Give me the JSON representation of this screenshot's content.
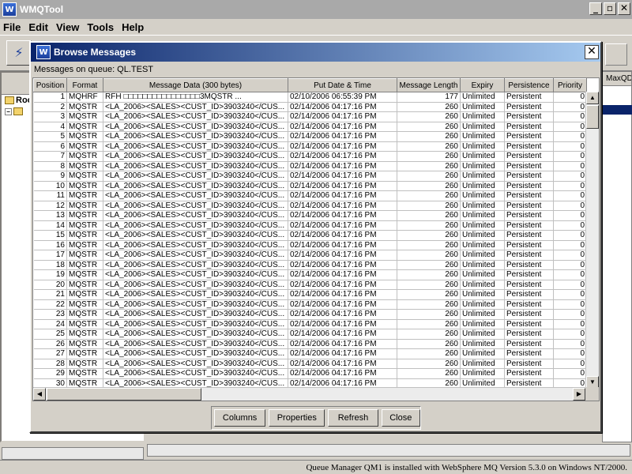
{
  "app": {
    "title": "WMQTool",
    "icon": "wmq-app-icon"
  },
  "window_controls": {
    "minimize": "_",
    "restore": "▫",
    "close": "✕"
  },
  "menu": [
    "File",
    "Edit",
    "View",
    "Tools",
    "Help"
  ],
  "tree": {
    "root_label": "Roo"
  },
  "right_panel": {
    "header": "MaxQD"
  },
  "status": {
    "text": "Queue Manager QM1 is installed with WebSphere MQ Version 5.3.0 on Windows NT/2000."
  },
  "dialog": {
    "title": "Browse Messages",
    "queue_label": "Messages on queue: QL.TEST",
    "columns": [
      "Position",
      "Format",
      "Message Data (300 bytes)",
      "Put Date & Time",
      "Message Length",
      "Expiry",
      "Persistence",
      "Priority"
    ],
    "rows": [
      [
        "1",
        "MQHRF",
        "RFH □□□□□□□□□□□□□□□□3MQSTR    ...",
        "02/10/2006 06:55:39 PM",
        "177",
        "Unlimited",
        "Persistent",
        "0"
      ],
      [
        "2",
        "MQSTR",
        "<LA_2006><SALES><CUST_ID>3903240</CUS...",
        "02/14/2006 04:17:16 PM",
        "260",
        "Unlimited",
        "Persistent",
        "0"
      ],
      [
        "3",
        "MQSTR",
        "<LA_2006><SALES><CUST_ID>3903240</CUS...",
        "02/14/2006 04:17:16 PM",
        "260",
        "Unlimited",
        "Persistent",
        "0"
      ],
      [
        "4",
        "MQSTR",
        "<LA_2006><SALES><CUST_ID>3903240</CUS...",
        "02/14/2006 04:17:16 PM",
        "260",
        "Unlimited",
        "Persistent",
        "0"
      ],
      [
        "5",
        "MQSTR",
        "<LA_2006><SALES><CUST_ID>3903240</CUS...",
        "02/14/2006 04:17:16 PM",
        "260",
        "Unlimited",
        "Persistent",
        "0"
      ],
      [
        "6",
        "MQSTR",
        "<LA_2006><SALES><CUST_ID>3903240</CUS...",
        "02/14/2006 04:17:16 PM",
        "260",
        "Unlimited",
        "Persistent",
        "0"
      ],
      [
        "7",
        "MQSTR",
        "<LA_2006><SALES><CUST_ID>3903240</CUS...",
        "02/14/2006 04:17:16 PM",
        "260",
        "Unlimited",
        "Persistent",
        "0"
      ],
      [
        "8",
        "MQSTR",
        "<LA_2006><SALES><CUST_ID>3903240</CUS...",
        "02/14/2006 04:17:16 PM",
        "260",
        "Unlimited",
        "Persistent",
        "0"
      ],
      [
        "9",
        "MQSTR",
        "<LA_2006><SALES><CUST_ID>3903240</CUS...",
        "02/14/2006 04:17:16 PM",
        "260",
        "Unlimited",
        "Persistent",
        "0"
      ],
      [
        "10",
        "MQSTR",
        "<LA_2006><SALES><CUST_ID>3903240</CUS...",
        "02/14/2006 04:17:16 PM",
        "260",
        "Unlimited",
        "Persistent",
        "0"
      ],
      [
        "11",
        "MQSTR",
        "<LA_2006><SALES><CUST_ID>3903240</CUS...",
        "02/14/2006 04:17:16 PM",
        "260",
        "Unlimited",
        "Persistent",
        "0"
      ],
      [
        "12",
        "MQSTR",
        "<LA_2006><SALES><CUST_ID>3903240</CUS...",
        "02/14/2006 04:17:16 PM",
        "260",
        "Unlimited",
        "Persistent",
        "0"
      ],
      [
        "13",
        "MQSTR",
        "<LA_2006><SALES><CUST_ID>3903240</CUS...",
        "02/14/2006 04:17:16 PM",
        "260",
        "Unlimited",
        "Persistent",
        "0"
      ],
      [
        "14",
        "MQSTR",
        "<LA_2006><SALES><CUST_ID>3903240</CUS...",
        "02/14/2006 04:17:16 PM",
        "260",
        "Unlimited",
        "Persistent",
        "0"
      ],
      [
        "15",
        "MQSTR",
        "<LA_2006><SALES><CUST_ID>3903240</CUS...",
        "02/14/2006 04:17:16 PM",
        "260",
        "Unlimited",
        "Persistent",
        "0"
      ],
      [
        "16",
        "MQSTR",
        "<LA_2006><SALES><CUST_ID>3903240</CUS...",
        "02/14/2006 04:17:16 PM",
        "260",
        "Unlimited",
        "Persistent",
        "0"
      ],
      [
        "17",
        "MQSTR",
        "<LA_2006><SALES><CUST_ID>3903240</CUS...",
        "02/14/2006 04:17:16 PM",
        "260",
        "Unlimited",
        "Persistent",
        "0"
      ],
      [
        "18",
        "MQSTR",
        "<LA_2006><SALES><CUST_ID>3903240</CUS...",
        "02/14/2006 04:17:16 PM",
        "260",
        "Unlimited",
        "Persistent",
        "0"
      ],
      [
        "19",
        "MQSTR",
        "<LA_2006><SALES><CUST_ID>3903240</CUS...",
        "02/14/2006 04:17:16 PM",
        "260",
        "Unlimited",
        "Persistent",
        "0"
      ],
      [
        "20",
        "MQSTR",
        "<LA_2006><SALES><CUST_ID>3903240</CUS...",
        "02/14/2006 04:17:16 PM",
        "260",
        "Unlimited",
        "Persistent",
        "0"
      ],
      [
        "21",
        "MQSTR",
        "<LA_2006><SALES><CUST_ID>3903240</CUS...",
        "02/14/2006 04:17:16 PM",
        "260",
        "Unlimited",
        "Persistent",
        "0"
      ],
      [
        "22",
        "MQSTR",
        "<LA_2006><SALES><CUST_ID>3903240</CUS...",
        "02/14/2006 04:17:16 PM",
        "260",
        "Unlimited",
        "Persistent",
        "0"
      ],
      [
        "23",
        "MQSTR",
        "<LA_2006><SALES><CUST_ID>3903240</CUS...",
        "02/14/2006 04:17:16 PM",
        "260",
        "Unlimited",
        "Persistent",
        "0"
      ],
      [
        "24",
        "MQSTR",
        "<LA_2006><SALES><CUST_ID>3903240</CUS...",
        "02/14/2006 04:17:16 PM",
        "260",
        "Unlimited",
        "Persistent",
        "0"
      ],
      [
        "25",
        "MQSTR",
        "<LA_2006><SALES><CUST_ID>3903240</CUS...",
        "02/14/2006 04:17:16 PM",
        "260",
        "Unlimited",
        "Persistent",
        "0"
      ],
      [
        "26",
        "MQSTR",
        "<LA_2006><SALES><CUST_ID>3903240</CUS...",
        "02/14/2006 04:17:16 PM",
        "260",
        "Unlimited",
        "Persistent",
        "0"
      ],
      [
        "27",
        "MQSTR",
        "<LA_2006><SALES><CUST_ID>3903240</CUS...",
        "02/14/2006 04:17:16 PM",
        "260",
        "Unlimited",
        "Persistent",
        "0"
      ],
      [
        "28",
        "MQSTR",
        "<LA_2006><SALES><CUST_ID>3903240</CUS...",
        "02/14/2006 04:17:16 PM",
        "260",
        "Unlimited",
        "Persistent",
        "0"
      ],
      [
        "29",
        "MQSTR",
        "<LA_2006><SALES><CUST_ID>3903240</CUS...",
        "02/14/2006 04:17:16 PM",
        "260",
        "Unlimited",
        "Persistent",
        "0"
      ],
      [
        "30",
        "MQSTR",
        "<LA_2006><SALES><CUST_ID>3903240</CUS...",
        "02/14/2006 04:17:16 PM",
        "260",
        "Unlimited",
        "Persistent",
        "0"
      ]
    ],
    "buttons": {
      "columns": "Columns",
      "properties": "Properties",
      "refresh": "Refresh",
      "close": "Close"
    },
    "close_glyph": "✕"
  },
  "colors": {
    "dialog_title_start": "#0a246a",
    "dialog_title_end": "#a6caf0",
    "selection": "#0a246a"
  }
}
